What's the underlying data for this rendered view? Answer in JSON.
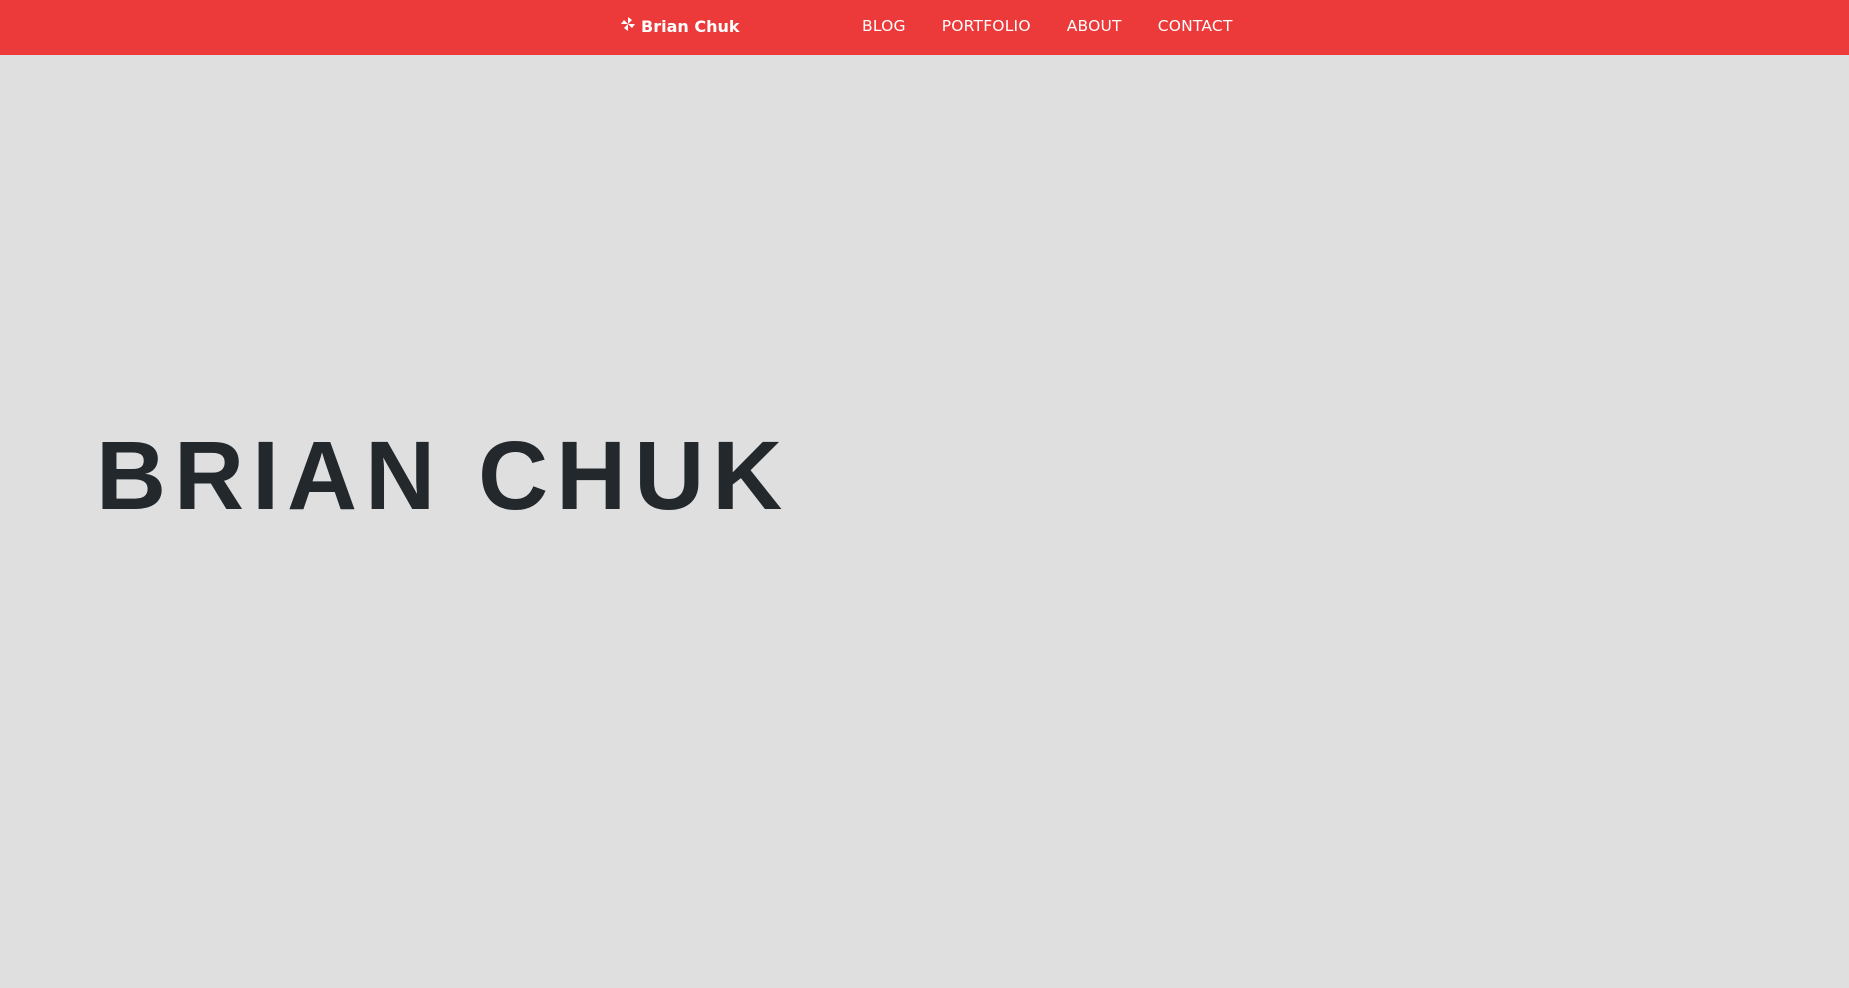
{
  "navbar": {
    "background_color": "#ec3a3a",
    "brand": {
      "icon": "pinwheel-icon",
      "label": "Brian Chuk"
    },
    "links": [
      {
        "label": "BLOG"
      },
      {
        "label": "PORTFOLIO"
      },
      {
        "label": "ABOUT"
      },
      {
        "label": "CONTACT"
      }
    ]
  },
  "hero": {
    "background_color": "#dfdfdf",
    "title": "BRIAN CHUK",
    "title_color": "#23282c"
  }
}
